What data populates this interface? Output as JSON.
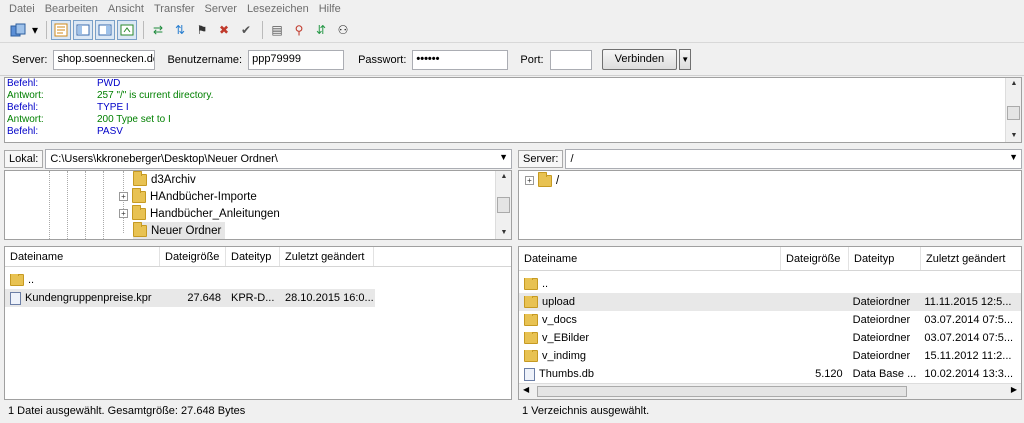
{
  "menu": [
    "Datei",
    "Bearbeiten",
    "Ansicht",
    "Transfer",
    "Server",
    "Lesezeichen",
    "Hilfe"
  ],
  "toolbar_icons": [
    "site-manager-icon",
    "dropdown-arrow-icon",
    "toggle-log-icon",
    "toggle-local-tree-icon",
    "toggle-remote-tree-icon",
    "toggle-queue-icon",
    "refresh-icon",
    "process-queue-icon",
    "cancel-icon",
    "disconnect-icon",
    "reconnect-icon",
    "filter-icon",
    "compare-icon",
    "sync-browse-icon",
    "find-icon"
  ],
  "quickconnect": {
    "server_label": "Server:",
    "server_value": "shop.soennecken.de",
    "user_label": "Benutzername:",
    "user_value": "ppp79999",
    "pass_label": "Passwort:",
    "pass_value": "••••••",
    "port_label": "Port:",
    "port_value": "",
    "connect_label": "Verbinden"
  },
  "log": [
    {
      "key": "Befehl:",
      "value": "PWD",
      "type": "cmd"
    },
    {
      "key": "Antwort:",
      "value": "257 \"/\" is current directory.",
      "type": "resp"
    },
    {
      "key": "Befehl:",
      "value": "TYPE I",
      "type": "cmd"
    },
    {
      "key": "Antwort:",
      "value": "200 Type set to I",
      "type": "resp"
    },
    {
      "key": "Befehl:",
      "value": "PASV",
      "type": "cmd"
    }
  ],
  "local": {
    "path_label": "Lokal:",
    "path_value": "C:\\Users\\kkroneberger\\Desktop\\Neuer Ordner\\",
    "tree": [
      "d3Archiv",
      "HAndbücher-Importe",
      "Handbücher_Anleitungen",
      "Neuer Ordner"
    ],
    "columns": [
      "Dateiname",
      "Dateigröße",
      "Dateityp",
      "Zuletzt geändert"
    ],
    "files": [
      {
        "name": "..",
        "size": "",
        "type": "",
        "date": ""
      },
      {
        "name": "Kundengruppenpreise.kpr",
        "size": "27.648",
        "type": "KPR-D...",
        "date": "28.10.2015 16:0..."
      }
    ],
    "status": "1 Datei ausgewählt. Gesamtgröße: 27.648 Bytes"
  },
  "remote": {
    "path_label": "Server:",
    "path_value": "/",
    "tree_root": "/",
    "columns": [
      "Dateiname",
      "Dateigröße",
      "Dateityp",
      "Zuletzt geändert"
    ],
    "files": [
      {
        "name": "..",
        "size": "",
        "type": "",
        "date": ""
      },
      {
        "name": "upload",
        "size": "",
        "type": "Dateiordner",
        "date": "11.11.2015 12:5..."
      },
      {
        "name": "v_docs",
        "size": "",
        "type": "Dateiordner",
        "date": "03.07.2014 07:5..."
      },
      {
        "name": "v_EBilder",
        "size": "",
        "type": "Dateiordner",
        "date": "03.07.2014 07:5..."
      },
      {
        "name": "v_indimg",
        "size": "",
        "type": "Dateiordner",
        "date": "15.11.2012 11:2..."
      },
      {
        "name": "Thumbs.db",
        "size": "5.120",
        "type": "Data Base ...",
        "date": "10.02.2014 13:3..."
      }
    ],
    "status": "1 Verzeichnis ausgewählt."
  }
}
